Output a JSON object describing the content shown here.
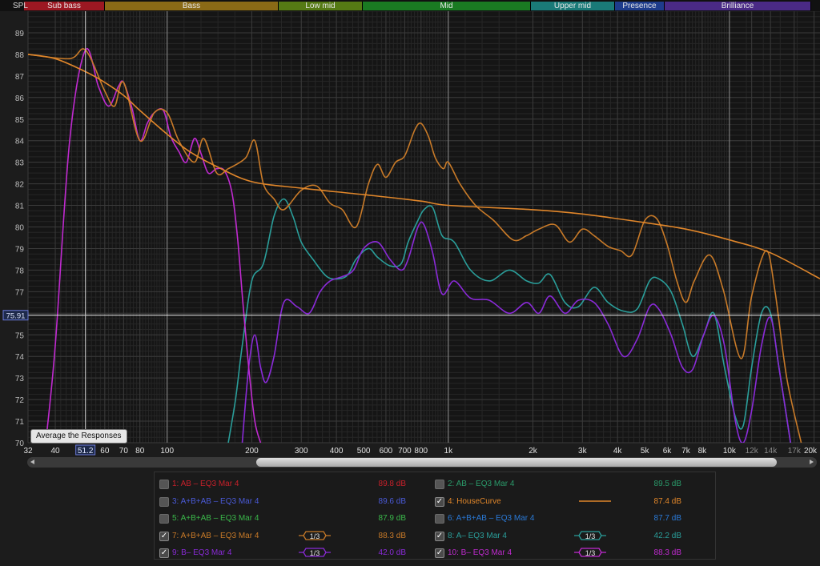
{
  "bands": [
    {
      "label": "Sub bass",
      "color": "#9c1822"
    },
    {
      "label": "Bass",
      "color": "#8a6a16"
    },
    {
      "label": "Low mid",
      "color": "#557a14"
    },
    {
      "label": "Mid",
      "color": "#1a7a22"
    },
    {
      "label": "Upper mid",
      "color": "#1a7a78"
    },
    {
      "label": "Presence",
      "color": "#1e3c8c"
    },
    {
      "label": "Brilliance",
      "color": "#4a2a86"
    }
  ],
  "axis": {
    "y_label": "SPL",
    "cursor_y": "75.91",
    "cursor_x": "51.2",
    "tooltip": "Average the Responses"
  },
  "chart_data": {
    "type": "line",
    "x_scale": "log",
    "xlim": [
      32,
      21000
    ],
    "ylim": [
      70,
      90
    ],
    "yticks": [
      "70",
      "71",
      "72",
      "73",
      "74",
      "75",
      "76",
      "77",
      "78",
      "79",
      "80",
      "81",
      "82",
      "83",
      "84",
      "85",
      "86",
      "87",
      "88",
      "89"
    ],
    "xticks": [
      "32",
      "40",
      "50",
      "60",
      "70",
      "80",
      "100",
      "200",
      "300",
      "400",
      "500",
      "600",
      "700",
      "800",
      "1k",
      "2k",
      "3k",
      "4k",
      "5k",
      "6k",
      "7k",
      "8k",
      "10k",
      "12k",
      "14k",
      "17k",
      "20k"
    ],
    "grid": true,
    "series": [
      {
        "name": "HouseCurve",
        "color": "#e0862a",
        "x": [
          32,
          40,
          51.2,
          60,
          70,
          80,
          100,
          120,
          150,
          200,
          300,
          500,
          800,
          1000,
          2000,
          3000,
          5000,
          7000,
          10000,
          14000,
          21000
        ],
        "y": [
          88.0,
          87.8,
          87.2,
          86.7,
          86.1,
          85.4,
          84.3,
          83.5,
          82.8,
          82.1,
          81.8,
          81.5,
          81.2,
          81.0,
          80.8,
          80.6,
          80.2,
          79.9,
          79.4,
          78.8,
          77.6
        ]
      },
      {
        "name": "7: A+B+AB – EQ3 Mar 4",
        "color": "#c87a28",
        "x": [
          32,
          45,
          51.2,
          60,
          65,
          70,
          80,
          90,
          100,
          110,
          125,
          135,
          150,
          165,
          190,
          205,
          220,
          240,
          260,
          300,
          340,
          380,
          420,
          470,
          520,
          560,
          600,
          650,
          700,
          760,
          800,
          850,
          900,
          960,
          1000,
          1100,
          1250,
          1450,
          1700,
          1900,
          2100,
          2400,
          2700,
          3000,
          3300,
          3700,
          4100,
          4500,
          5000,
          5500,
          6000,
          6500,
          7000,
          7500,
          8500,
          9500,
          11000,
          12000,
          13500,
          14500,
          16000,
          18000
        ],
        "y": [
          88.0,
          87.8,
          88.2,
          86.3,
          85.6,
          86.7,
          84.0,
          85.3,
          85.3,
          84.0,
          83.0,
          84.1,
          82.5,
          82.7,
          83.2,
          84.0,
          82.0,
          81.3,
          80.8,
          81.7,
          81.9,
          81.1,
          80.8,
          80.0,
          82.0,
          82.9,
          82.3,
          83.0,
          83.3,
          84.5,
          84.8,
          84.2,
          83.2,
          82.7,
          83.0,
          82.0,
          81.0,
          80.3,
          79.4,
          79.6,
          79.9,
          80.1,
          79.3,
          79.9,
          79.6,
          79.1,
          78.9,
          78.7,
          80.3,
          80.4,
          79.2,
          77.5,
          76.5,
          77.5,
          78.7,
          77.1,
          73.9,
          76.8,
          78.9,
          77.1,
          73.0,
          70.0
        ]
      },
      {
        "name": "8: A– EQ3 Mar 4",
        "color": "#2a9e9a",
        "x": [
          165,
          175,
          185,
          200,
          220,
          240,
          260,
          280,
          300,
          330,
          370,
          410,
          440,
          470,
          520,
          560,
          620,
          680,
          720,
          780,
          820,
          880,
          950,
          1050,
          1200,
          1400,
          1650,
          1900,
          2100,
          2300,
          2600,
          2900,
          3300,
          3700,
          4200,
          4700,
          5200,
          5600,
          6200,
          6800,
          7400,
          8100,
          8800,
          9600,
          10500,
          11200,
          12000,
          13000,
          14000,
          15000,
          16500
        ],
        "y": [
          70.0,
          72.0,
          74.5,
          77.5,
          78.3,
          80.5,
          81.3,
          80.5,
          79.3,
          78.5,
          77.7,
          77.6,
          77.8,
          78.5,
          79.0,
          78.6,
          78.2,
          78.3,
          79.3,
          80.3,
          80.8,
          80.9,
          79.6,
          79.3,
          78.0,
          77.5,
          78.0,
          77.5,
          77.4,
          77.8,
          76.5,
          76.3,
          77.2,
          76.5,
          76.1,
          76.2,
          77.5,
          77.6,
          77.0,
          75.5,
          74.0,
          75.0,
          76.0,
          73.5,
          71.2,
          70.8,
          73.5,
          76.0,
          76.0,
          73.5,
          70.0
        ]
      },
      {
        "name": "9: B– EQ3 Mar 4",
        "color": "#8a2ad8",
        "x": [
          185,
          195,
          205,
          215,
          225,
          240,
          260,
          290,
          320,
          350,
          380,
          420,
          460,
          500,
          560,
          620,
          680,
          720,
          780,
          820,
          880,
          950,
          1050,
          1200,
          1400,
          1650,
          1900,
          2100,
          2300,
          2600,
          2900,
          3300,
          3700,
          4200,
          4700,
          5200,
          5600,
          6200,
          6800,
          7400,
          8100,
          8800,
          9600,
          10500,
          11200,
          12000,
          13000,
          14000,
          15000,
          16500
        ],
        "y": [
          70.0,
          73.5,
          75.0,
          73.5,
          72.8,
          74.0,
          76.5,
          76.3,
          76.0,
          77.0,
          77.5,
          77.7,
          78.0,
          79.0,
          79.3,
          78.5,
          78.0,
          78.5,
          80.0,
          80.1,
          78.8,
          76.9,
          77.5,
          76.7,
          76.6,
          76.0,
          76.5,
          76.0,
          76.8,
          76.0,
          76.6,
          76.5,
          75.5,
          74.0,
          74.8,
          76.3,
          76.2,
          75.0,
          73.5,
          73.4,
          75.0,
          75.9,
          74.5,
          71.0,
          70.0,
          71.5,
          74.5,
          75.8,
          73.5,
          70.0
        ]
      },
      {
        "name": "10: B– EQ3 Mar 4",
        "color": "#c02ad0",
        "x": [
          37,
          40,
          45,
          51.2,
          57,
          62,
          67,
          70,
          75,
          80,
          85,
          90,
          97,
          103,
          110,
          117,
          125,
          132,
          140,
          150,
          160,
          170,
          178,
          186,
          195,
          205,
          215
        ],
        "y": [
          70.0,
          74.5,
          84.0,
          88.2,
          86.5,
          85.6,
          86.5,
          86.7,
          85.5,
          84.0,
          84.8,
          85.3,
          85.4,
          84.2,
          83.5,
          83.0,
          84.1,
          83.4,
          82.5,
          82.7,
          82.6,
          81.6,
          79.5,
          76.5,
          73.5,
          71.0,
          70.0
        ]
      }
    ]
  },
  "legend": [
    {
      "id": "1",
      "label": "1: AB – EQ3 Mar 4",
      "value": "89.8 dB",
      "color": "#c8202a",
      "checked": false,
      "badge": ""
    },
    {
      "id": "2",
      "label": "2: AB – EQ3 Mar 4",
      "value": "89.5 dB",
      "color": "#2a9a6a",
      "checked": false,
      "badge": ""
    },
    {
      "id": "3",
      "label": "3: A+B+AB – EQ3 Mar 4",
      "value": "89.6 dB",
      "color": "#4a5ad8",
      "checked": false,
      "badge": ""
    },
    {
      "id": "4",
      "label": "4: HouseCurve",
      "value": "87.4 dB",
      "color": "#e0862a",
      "checked": true,
      "badge": "line"
    },
    {
      "id": "5",
      "label": "5: A+B+AB – EQ3 Mar 4",
      "value": "87.9 dB",
      "color": "#3ab84a",
      "checked": false,
      "badge": ""
    },
    {
      "id": "6",
      "label": "6: A+B+AB – EQ3 Mar 4",
      "value": "87.7 dB",
      "color": "#2a7ad8",
      "checked": false,
      "badge": ""
    },
    {
      "id": "7",
      "label": "7: A+B+AB – EQ3 Mar 4",
      "value": "88.3 dB",
      "color": "#c87a28",
      "checked": true,
      "badge": "1/3"
    },
    {
      "id": "8",
      "label": "8: A– EQ3 Mar 4",
      "value": "42.2 dB",
      "color": "#2a9e9a",
      "checked": true,
      "badge": "1/3"
    },
    {
      "id": "9",
      "label": "9: B– EQ3 Mar 4",
      "value": "42.0 dB",
      "color": "#8a2ad8",
      "checked": true,
      "badge": "1/3"
    },
    {
      "id": "10",
      "label": "10: B– EQ3 Mar 4",
      "value": "88.3 dB",
      "color": "#c02ad0",
      "checked": true,
      "badge": "1/3"
    }
  ],
  "icons": {
    "check": "checkmark-icon",
    "scroll_left": "arrow-left-icon",
    "scroll_right": "arrow-right-icon"
  }
}
